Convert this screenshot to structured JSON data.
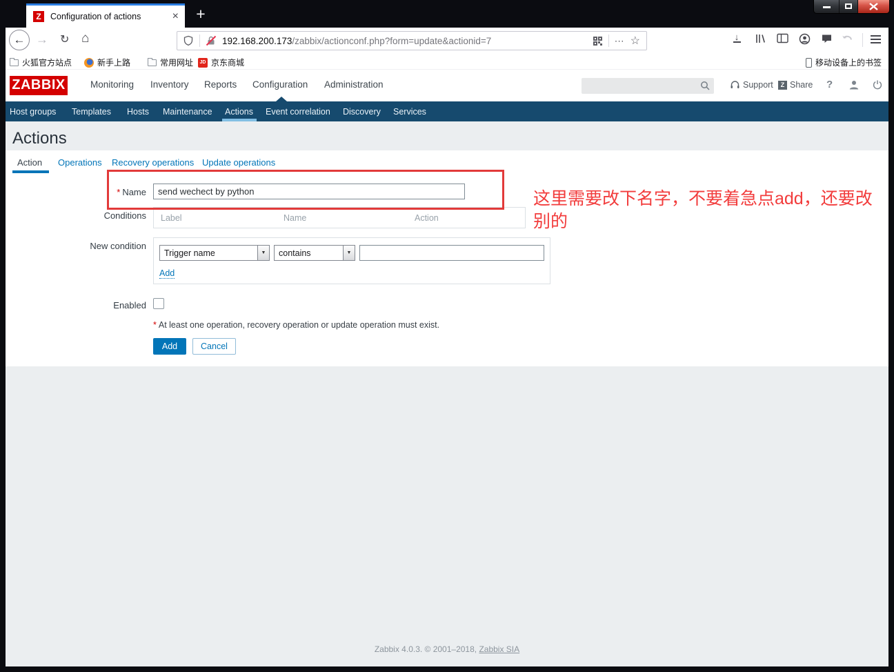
{
  "browser": {
    "tab_title": "Configuration of actions",
    "url_domain": "192.168.200.173",
    "url_path": "/zabbix/actionconf.php?form=update&actionid=7",
    "bookmarks": [
      {
        "label": "火狐官方站点",
        "icon": "folder"
      },
      {
        "label": "新手上路",
        "icon": "firefox"
      },
      {
        "label": "常用网址",
        "icon": "folder"
      },
      {
        "label": "京东商城",
        "icon": "jd-logo"
      }
    ],
    "mobile_bookmarks_label": "移动设备上的书签"
  },
  "icons": {
    "back": "←",
    "forward": "→",
    "reload": "↻",
    "home": "⌂",
    "overflow_dots": "⋯",
    "bookmark_star": "☆",
    "download_arrow": "↓",
    "new_tab": "+",
    "close_tab": "×",
    "dropdown_arrow": "▼",
    "tab_favicon": "Z",
    "share_badge": "Z",
    "jd_badge": "JD",
    "help": "?"
  },
  "zabbix": {
    "logo_text": "ZABBIX",
    "top_nav": [
      {
        "label": "Monitoring",
        "active": false
      },
      {
        "label": "Inventory",
        "active": false
      },
      {
        "label": "Reports",
        "active": false
      },
      {
        "label": "Configuration",
        "active": true
      },
      {
        "label": "Administration",
        "active": false
      }
    ],
    "header_links": {
      "support": "Support",
      "share": "Share"
    },
    "sub_nav": [
      {
        "label": "Host groups",
        "active": false
      },
      {
        "label": "Templates",
        "active": false
      },
      {
        "label": "Hosts",
        "active": false
      },
      {
        "label": "Maintenance",
        "active": false
      },
      {
        "label": "Actions",
        "active": true
      },
      {
        "label": "Event correlation",
        "active": false
      },
      {
        "label": "Discovery",
        "active": false
      },
      {
        "label": "Services",
        "active": false
      }
    ],
    "page_title": "Actions",
    "tabs": [
      {
        "label": "Action",
        "active": true
      },
      {
        "label": "Operations",
        "active": false
      },
      {
        "label": "Recovery operations",
        "active": false
      },
      {
        "label": "Update operations",
        "active": false
      }
    ],
    "form": {
      "required_mark": "*",
      "name_label": "Name",
      "name_value": "send wechect by python",
      "conditions_label": "Conditions",
      "conditions_headers": [
        "Label",
        "Name",
        "Action"
      ],
      "new_condition_label": "New condition",
      "condition_type_value": "Trigger name",
      "condition_operator_value": "contains",
      "condition_text_value": "",
      "add_condition_link": "Add",
      "enabled_label": "Enabled",
      "required_note": "At least one operation, recovery operation or update operation must exist.",
      "add_button": "Add",
      "cancel_button": "Cancel"
    },
    "footer_text": "Zabbix 4.0.3. © 2001–2018, ",
    "footer_link": "Zabbix SIA"
  },
  "annotation": {
    "text": "这里需要改下名字，不要着急点add，还要改别的",
    "color": "#f23c3c"
  },
  "colors": {
    "zabbix_red": "#d40000",
    "link_blue": "#0275b8",
    "subnav_bg": "#164a6e",
    "subnav_active_underline": "#82bfe4",
    "page_bg": "#ebeef0",
    "annotation_red": "#f23c3c"
  }
}
